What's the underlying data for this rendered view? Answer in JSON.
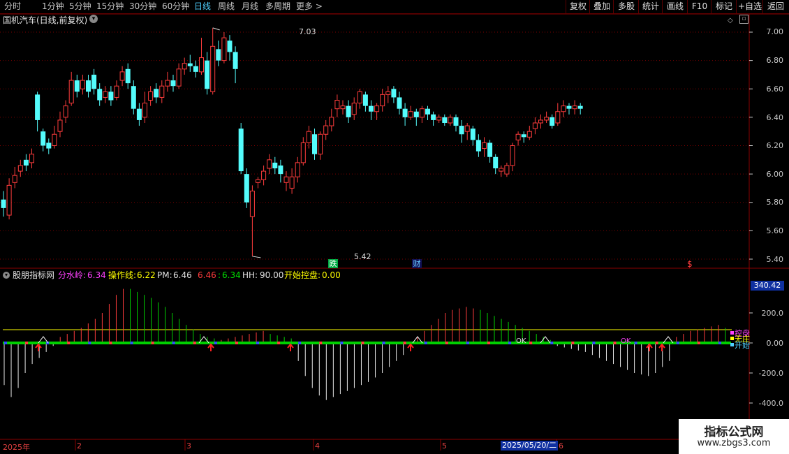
{
  "toolbar": {
    "periods": [
      "分时",
      "1分钟",
      "5分钟",
      "15分钟",
      "30分钟",
      "60分钟",
      "日线",
      "周线",
      "月线",
      "多周期",
      "更多 >"
    ],
    "active": "日线",
    "right_buttons": [
      "复权",
      "叠加",
      "多股",
      "统计",
      "画线",
      "F10",
      "标记",
      "+自选",
      "返回"
    ]
  },
  "main": {
    "title": "国机汽车(日线,前复权)",
    "price_axis": [
      "7.00",
      "6.80",
      "6.60",
      "6.40",
      "6.20",
      "6.00",
      "5.80",
      "5.60",
      "5.40"
    ],
    "high_marker": "7.03",
    "low_marker": "5.42",
    "event_fall": "跌",
    "event_fin": "财",
    "event_s": "$"
  },
  "indicator": {
    "name": "股朋指标网",
    "label1": "分水岭:",
    "value1": "6.34",
    "label2": "操作线:",
    "value2": "6.22",
    "label3": "PM:",
    "value3": "6.46",
    "value4": "6.46",
    "label5": ":",
    "value5": "6.34",
    "label6": "HH:",
    "value6": "90.00",
    "label7": "开始控盘:",
    "value7": "0.00",
    "axis": [
      "340.42",
      "200.0",
      "0.00",
      "-200.0",
      "-400.0"
    ],
    "legend": [
      "控盘",
      "无庄",
      "开始"
    ],
    "marks": [
      "OK",
      "OK"
    ]
  },
  "dates": {
    "year": "2025年",
    "m2": "2",
    "m3": "3",
    "m4": "4",
    "m5": "5",
    "cursor": "2025/05/20/二",
    "m6": "6"
  },
  "watermark": {
    "title": "指标公式网",
    "url": "www.zbgs3.com"
  },
  "colors": {
    "up": "#ff3c3c",
    "down": "#54fcfc",
    "grid": "#7a0000",
    "yellow": "#ffff00",
    "green": "#00d000",
    "magenta": "#ff40ff"
  },
  "chart_data": {
    "type": "candlestick",
    "ylim": [
      5.4,
      7.0
    ],
    "candles": [
      [
        5.82,
        5.76,
        5.88,
        5.7
      ],
      [
        5.71,
        5.92,
        5.97,
        5.68
      ],
      [
        5.94,
        5.99,
        6.05,
        5.9
      ],
      [
        6.02,
        6.06,
        6.1,
        5.98
      ],
      [
        6.1,
        6.06,
        6.14,
        6.02
      ],
      [
        6.08,
        6.14,
        6.18,
        6.04
      ],
      [
        6.56,
        6.38,
        6.58,
        6.3
      ],
      [
        6.3,
        6.2,
        6.32,
        6.16
      ],
      [
        6.22,
        6.18,
        6.25,
        6.14
      ],
      [
        6.2,
        6.28,
        6.34,
        6.18
      ],
      [
        6.3,
        6.38,
        6.44,
        6.26
      ],
      [
        6.4,
        6.48,
        6.52,
        6.36
      ],
      [
        6.5,
        6.66,
        6.72,
        6.48
      ],
      [
        6.66,
        6.58,
        6.7,
        6.54
      ],
      [
        6.6,
        6.66,
        6.7,
        6.56
      ],
      [
        6.66,
        6.58,
        6.7,
        6.54
      ],
      [
        6.7,
        6.6,
        6.74,
        6.56
      ],
      [
        6.6,
        6.52,
        6.64,
        6.48
      ],
      [
        6.54,
        6.58,
        6.62,
        6.5
      ],
      [
        6.58,
        6.52,
        6.62,
        6.48
      ],
      [
        6.54,
        6.62,
        6.66,
        6.52
      ],
      [
        6.66,
        6.72,
        6.76,
        6.62
      ],
      [
        6.74,
        6.64,
        6.78,
        6.6
      ],
      [
        6.62,
        6.46,
        6.66,
        6.42
      ],
      [
        6.46,
        6.38,
        6.5,
        6.34
      ],
      [
        6.4,
        6.5,
        6.58,
        6.36
      ],
      [
        6.52,
        6.58,
        6.62,
        6.48
      ],
      [
        6.6,
        6.54,
        6.64,
        6.5
      ],
      [
        6.54,
        6.62,
        6.66,
        6.5
      ],
      [
        6.62,
        6.66,
        6.72,
        6.58
      ],
      [
        6.66,
        6.62,
        6.7,
        6.58
      ],
      [
        6.62,
        6.74,
        6.78,
        6.6
      ],
      [
        6.74,
        6.78,
        6.82,
        6.7
      ],
      [
        6.78,
        6.76,
        6.84,
        6.72
      ],
      [
        6.76,
        6.72,
        6.8,
        6.68
      ],
      [
        6.72,
        6.82,
        6.96,
        6.7
      ],
      [
        6.8,
        6.6,
        6.86,
        6.56
      ],
      [
        6.58,
        6.9,
        7.03,
        6.56
      ],
      [
        6.88,
        6.8,
        6.94,
        6.76
      ],
      [
        6.8,
        6.96,
        7.0,
        6.78
      ],
      [
        6.94,
        6.86,
        6.98,
        6.8
      ],
      [
        6.86,
        6.74,
        6.9,
        6.64
      ],
      [
        6.32,
        6.02,
        6.36,
        6.0
      ],
      [
        6.0,
        5.8,
        6.04,
        5.76
      ],
      [
        5.7,
        5.88,
        5.92,
        5.42
      ],
      [
        5.94,
        5.96,
        5.98,
        5.9
      ],
      [
        5.96,
        6.02,
        6.06,
        5.92
      ],
      [
        6.04,
        6.1,
        6.14,
        6.0
      ],
      [
        6.08,
        6.04,
        6.12,
        6.0
      ],
      [
        6.06,
        6.0,
        6.1,
        5.94
      ],
      [
        5.94,
        5.98,
        6.02,
        5.88
      ],
      [
        5.9,
        5.98,
        6.04,
        5.86
      ],
      [
        5.98,
        6.08,
        6.12,
        5.94
      ],
      [
        6.08,
        6.22,
        6.26,
        6.06
      ],
      [
        6.22,
        6.3,
        6.34,
        6.18
      ],
      [
        6.28,
        6.14,
        6.32,
        6.1
      ],
      [
        6.14,
        6.28,
        6.3,
        6.1
      ],
      [
        6.28,
        6.34,
        6.38,
        6.24
      ],
      [
        6.34,
        6.4,
        6.46,
        6.3
      ],
      [
        6.46,
        6.52,
        6.56,
        6.4
      ],
      [
        6.46,
        6.48,
        6.52,
        6.42
      ],
      [
        6.48,
        6.4,
        6.52,
        6.36
      ],
      [
        6.42,
        6.5,
        6.54,
        6.38
      ],
      [
        6.5,
        6.58,
        6.6,
        6.46
      ],
      [
        6.56,
        6.48,
        6.58,
        6.44
      ],
      [
        6.48,
        6.44,
        6.52,
        6.38
      ],
      [
        6.44,
        6.48,
        6.5,
        6.38
      ],
      [
        6.48,
        6.56,
        6.6,
        6.44
      ],
      [
        6.56,
        6.58,
        6.62,
        6.5
      ],
      [
        6.6,
        6.54,
        6.62,
        6.5
      ],
      [
        6.54,
        6.46,
        6.58,
        6.42
      ],
      [
        6.46,
        6.4,
        6.5,
        6.34
      ],
      [
        6.4,
        6.44,
        6.48,
        6.38
      ],
      [
        6.44,
        6.4,
        6.46,
        6.34
      ],
      [
        6.4,
        6.46,
        6.48,
        6.36
      ],
      [
        6.46,
        6.42,
        6.48,
        6.38
      ],
      [
        6.42,
        6.38,
        6.44,
        6.34
      ],
      [
        6.38,
        6.4,
        6.42,
        6.36
      ],
      [
        6.4,
        6.36,
        6.42,
        6.34
      ],
      [
        6.36,
        6.4,
        6.42,
        6.34
      ],
      [
        6.4,
        6.34,
        6.42,
        6.3
      ],
      [
        6.34,
        6.28,
        6.38,
        6.22
      ],
      [
        6.3,
        6.34,
        6.36,
        6.24
      ],
      [
        6.32,
        6.24,
        6.34,
        6.2
      ],
      [
        6.24,
        6.16,
        6.28,
        6.12
      ],
      [
        6.18,
        6.22,
        6.26,
        6.12
      ],
      [
        6.22,
        6.12,
        6.24,
        6.08
      ],
      [
        6.12,
        6.04,
        6.14,
        6.0
      ],
      [
        6.02,
        6.04,
        6.06,
        5.98
      ],
      [
        6.0,
        6.06,
        6.08,
        5.98
      ],
      [
        6.06,
        6.2,
        6.22,
        6.02
      ],
      [
        6.24,
        6.28,
        6.3,
        6.2
      ],
      [
        6.28,
        6.26,
        6.3,
        6.22
      ],
      [
        6.26,
        6.3,
        6.34,
        6.24
      ],
      [
        6.32,
        6.36,
        6.4,
        6.28
      ],
      [
        6.36,
        6.38,
        6.42,
        6.32
      ],
      [
        6.38,
        6.4,
        6.44,
        6.36
      ],
      [
        6.4,
        6.34,
        6.42,
        6.32
      ],
      [
        6.36,
        6.44,
        6.5,
        6.34
      ],
      [
        6.44,
        6.48,
        6.52,
        6.4
      ],
      [
        6.48,
        6.46,
        6.5,
        6.42
      ],
      [
        6.46,
        6.48,
        6.52,
        6.42
      ],
      [
        6.48,
        6.46,
        6.5,
        6.42
      ]
    ],
    "indicator_bars": [
      [
        -280,
        0
      ],
      [
        -360,
        0
      ],
      [
        -300,
        0
      ],
      [
        -200,
        0
      ],
      [
        -140,
        0
      ],
      [
        -100,
        0
      ],
      [
        -60,
        0
      ],
      [
        -20,
        0
      ],
      [
        40,
        1
      ],
      [
        60,
        1
      ],
      [
        80,
        1
      ],
      [
        100,
        1
      ],
      [
        130,
        1
      ],
      [
        160,
        1
      ],
      [
        200,
        1
      ],
      [
        260,
        1
      ],
      [
        320,
        1
      ],
      [
        360,
        1
      ],
      [
        360,
        0
      ],
      [
        340,
        0
      ],
      [
        320,
        0
      ],
      [
        300,
        0
      ],
      [
        270,
        0
      ],
      [
        240,
        0
      ],
      [
        200,
        0
      ],
      [
        160,
        0
      ],
      [
        120,
        0
      ],
      [
        90,
        0
      ],
      [
        60,
        0
      ],
      [
        40,
        0
      ],
      [
        30,
        0
      ],
      [
        20,
        1
      ],
      [
        30,
        1
      ],
      [
        40,
        1
      ],
      [
        50,
        1
      ],
      [
        60,
        1
      ],
      [
        70,
        1
      ],
      [
        80,
        1
      ],
      [
        60,
        0
      ],
      [
        50,
        0
      ],
      [
        40,
        0
      ],
      [
        30,
        0
      ],
      [
        -120,
        0
      ],
      [
        -220,
        0
      ],
      [
        -300,
        0
      ],
      [
        -350,
        0
      ],
      [
        -380,
        0
      ],
      [
        -360,
        0
      ],
      [
        -340,
        0
      ],
      [
        -320,
        0
      ],
      [
        -300,
        0
      ],
      [
        -280,
        0
      ],
      [
        -260,
        0
      ],
      [
        -230,
        0
      ],
      [
        -200,
        0
      ],
      [
        -160,
        0
      ],
      [
        -120,
        0
      ],
      [
        -80,
        0
      ],
      [
        -40,
        0
      ],
      [
        40,
        1
      ],
      [
        80,
        1
      ],
      [
        120,
        1
      ],
      [
        160,
        1
      ],
      [
        200,
        1
      ],
      [
        220,
        1
      ],
      [
        230,
        1
      ],
      [
        240,
        1
      ],
      [
        230,
        1
      ],
      [
        220,
        0
      ],
      [
        200,
        0
      ],
      [
        180,
        0
      ],
      [
        160,
        0
      ],
      [
        140,
        0
      ],
      [
        120,
        0
      ],
      [
        100,
        0
      ],
      [
        80,
        0
      ],
      [
        60,
        0
      ],
      [
        40,
        0
      ],
      [
        20,
        0
      ],
      [
        -20,
        0
      ],
      [
        -30,
        0
      ],
      [
        -40,
        0
      ],
      [
        -50,
        0
      ],
      [
        -60,
        0
      ],
      [
        -80,
        0
      ],
      [
        -100,
        0
      ],
      [
        -120,
        0
      ],
      [
        -140,
        0
      ],
      [
        -160,
        0
      ],
      [
        -180,
        0
      ],
      [
        -200,
        0
      ],
      [
        -210,
        0
      ],
      [
        -220,
        0
      ],
      [
        -200,
        0
      ],
      [
        -160,
        0
      ],
      [
        -120,
        0
      ],
      [
        40,
        1
      ],
      [
        60,
        1
      ],
      [
        80,
        1
      ],
      [
        90,
        1
      ],
      [
        100,
        1
      ],
      [
        110,
        1
      ],
      [
        120,
        1
      ],
      [
        100,
        0
      ]
    ]
  }
}
